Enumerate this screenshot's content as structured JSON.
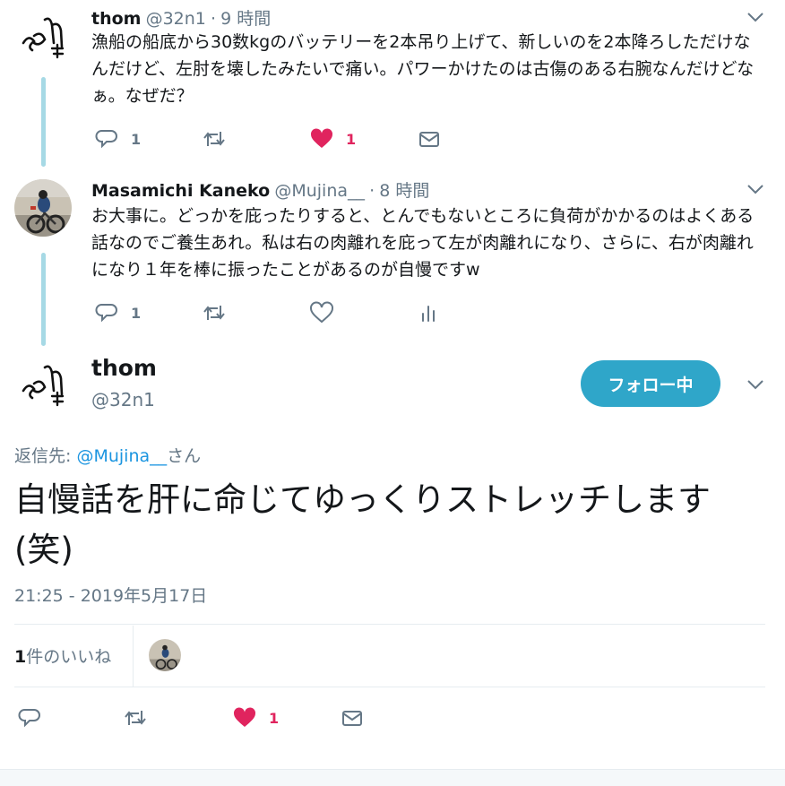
{
  "tweets": [
    {
      "name": "thom",
      "handle": "@32n1",
      "separator": "·",
      "time": "9 時間",
      "text": "漁船の船底から30数kgのバッテリーを2本吊り上げて、新しいのを2本降ろしただけなんだけど、左肘を壊したみたいで痛い。パワーかけたのは古傷のある右腕なんだけどなぁ。なぜだ？",
      "actions": {
        "reply_count": "1",
        "retweet_count": "",
        "like_count": "1",
        "liked": true,
        "extra_icon": "envelope-icon"
      }
    },
    {
      "name": "Masamichi Kaneko",
      "handle": "@Mujina__",
      "separator": "·",
      "time": "8 時間",
      "text": "お大事に。どっかを庇ったりすると、とんでもないところに負荷がかかるのはよくある話なのでご養生あれ。私は右の肉離れを庇って左が肉離れになり、さらに、右が肉離れになり１年を棒に振ったことがあるのが自慢ですw",
      "actions": {
        "reply_count": "1",
        "retweet_count": "",
        "like_count": "",
        "liked": false,
        "extra_icon": "analytics-icon"
      }
    }
  ],
  "main_tweet": {
    "name": "thom",
    "handle": "@32n1",
    "follow_label": "フォロー中",
    "reply_to_prefix": "返信先: ",
    "reply_to_mention": "@Mujina__",
    "reply_to_suffix": "さん",
    "text": "自慢話を肝に命じてゆっくりストレッチします(笑)",
    "timestamp": "21:25 - 2019年5月17日",
    "likes_number": "1",
    "likes_label": "件のいいね",
    "actions": {
      "reply_count": "",
      "retweet_count": "",
      "like_count": "1",
      "liked": true
    }
  },
  "colors": {
    "accent": "#2fa6c9",
    "like": "#e0245e",
    "thread_line": "#a6d9e5",
    "muted": "#657786"
  }
}
